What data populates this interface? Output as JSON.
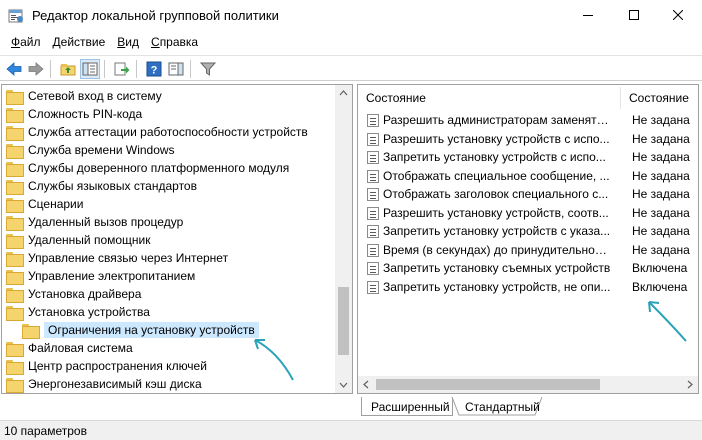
{
  "window": {
    "title": "Редактор локальной групповой политики",
    "icon": "policy-editor-icon"
  },
  "menu": [
    {
      "mnemonic": "Ф",
      "rest": "айл"
    },
    {
      "mnemonic": "Д",
      "rest": "ействие"
    },
    {
      "mnemonic": "В",
      "rest": "ид"
    },
    {
      "mnemonic": "С",
      "rest": "правка"
    }
  ],
  "toolbar": {
    "icons": [
      "back-arrow-icon",
      "forward-arrow-icon",
      "up-folder-icon",
      "show-hide-tree-icon",
      "export-list-icon",
      "help-icon",
      "properties-pane-icon",
      "filter-icon"
    ]
  },
  "tree": {
    "items": [
      {
        "label": "Сетевой вход в систему"
      },
      {
        "label": "Сложность PIN-кода"
      },
      {
        "label": "Служба аттестации работоспособности устройств"
      },
      {
        "label": "Служба времени Windows"
      },
      {
        "label": "Службы доверенного платформенного модуля"
      },
      {
        "label": "Службы языковых стандартов"
      },
      {
        "label": "Сценарии"
      },
      {
        "label": "Удаленный вызов процедур"
      },
      {
        "label": "Удаленный помощник"
      },
      {
        "label": "Управление связью через Интернет"
      },
      {
        "label": "Управление электропитанием"
      },
      {
        "label": "Установка драйвера"
      },
      {
        "label": "Установка устройства"
      },
      {
        "label": "Ограничения на установку устройств",
        "selected": true
      },
      {
        "label": "Файловая система"
      },
      {
        "label": "Центр распространения ключей"
      },
      {
        "label": "Энергонезависимый кэш диска"
      }
    ]
  },
  "list": {
    "columns": [
      "Состояние",
      "Состояние"
    ],
    "rows": [
      {
        "name": "Разрешить администраторам заменять...",
        "state": "Не задана"
      },
      {
        "name": "Разрешить установку устройств с испо...",
        "state": "Не задана"
      },
      {
        "name": "Запретить установку устройств с испо...",
        "state": "Не задана"
      },
      {
        "name": "Отображать специальное сообщение, ...",
        "state": "Не задана"
      },
      {
        "name": "Отображать заголовок специального с...",
        "state": "Не задана"
      },
      {
        "name": "Разрешить установку устройств, соотв...",
        "state": "Не задана"
      },
      {
        "name": "Запретить установку устройств с указа...",
        "state": "Не задана"
      },
      {
        "name": "Время (в секундах) до принудительной...",
        "state": "Не задана"
      },
      {
        "name": "Запретить установку съемных устройств",
        "state": "Включена"
      },
      {
        "name": "Запретить установку устройств, не опи...",
        "state": "Включена"
      }
    ]
  },
  "tabs": [
    "Расширенный",
    "Стандартный"
  ],
  "status": {
    "text": "10 параметров"
  },
  "colors": {
    "selection": "#cce8ff",
    "annotation_arrow": "#2aa3b8",
    "folder": "#f5d46e"
  }
}
